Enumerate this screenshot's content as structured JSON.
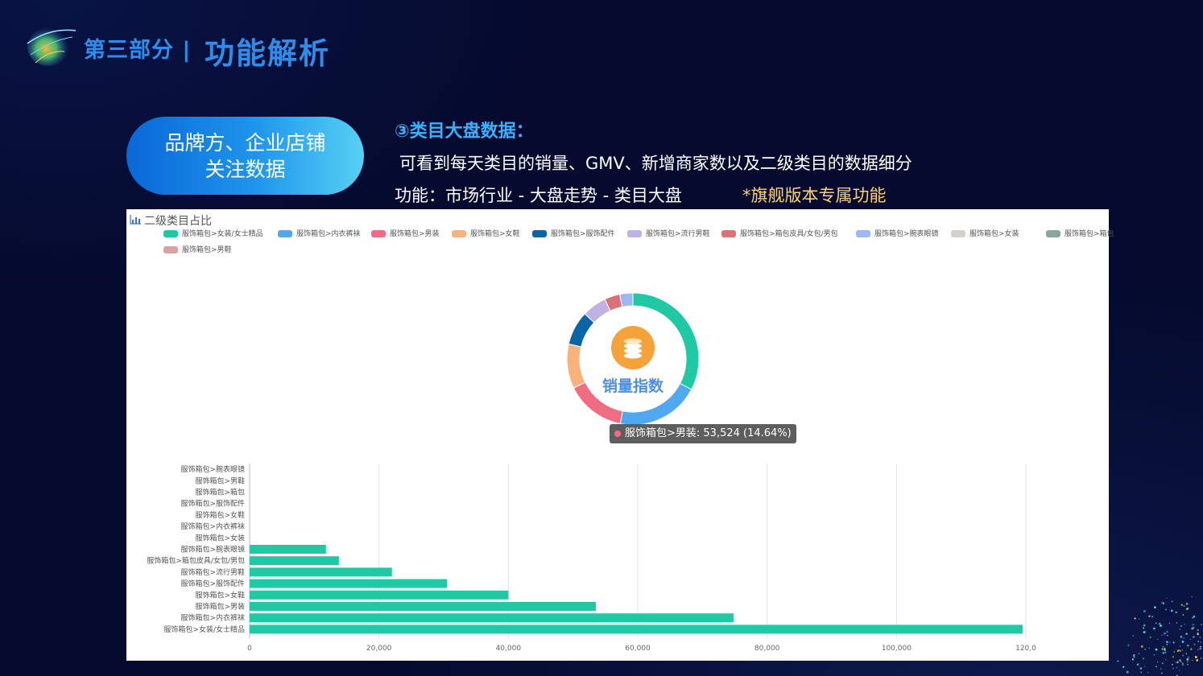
{
  "header": {
    "section_label": "第三部分 |",
    "section_title": "功能解析"
  },
  "pill": {
    "line1": "品牌方、企业店铺",
    "line2": "关注数据"
  },
  "feature": {
    "title": "③类目大盘数据：",
    "description": "可看到每天类目的销量、GMV、新增商家数以及二级类目的数据细分",
    "path": "功能：市场行业 - 大盘走势 - 类目大盘",
    "note": "*旗舰版本专属功能"
  },
  "panel": {
    "title": "二级类目占比",
    "center_label": "销量指数",
    "center_icon": "coins-icon",
    "tooltip": "服饰箱包>男装: 53,524 (14.64%)"
  },
  "legend": [
    {
      "label": "服饰箱包>女装/女士精品",
      "color": "#1ec9a3"
    },
    {
      "label": "服饰箱包>内衣裤袜",
      "color": "#4fa8f0"
    },
    {
      "label": "服饰箱包>男装",
      "color": "#f06c83"
    },
    {
      "label": "服饰箱包>女鞋",
      "color": "#f8b27a"
    },
    {
      "label": "服饰箱包>服饰配件",
      "color": "#0a64a8"
    },
    {
      "label": "服饰箱包>流行男鞋",
      "color": "#c0b3e4"
    },
    {
      "label": "服饰箱包>箱包皮具/女包/男包",
      "color": "#db7178"
    },
    {
      "label": "服饰箱包>腕表眼镜",
      "color": "#9ab8f6"
    },
    {
      "label": "服饰箱包>女装",
      "color": "#d8d0c8"
    },
    {
      "label": "服饰箱包>箱包",
      "color": "#8aa89a"
    },
    {
      "label": "服饰箱包>男鞋",
      "color": "#dba1a6"
    }
  ],
  "chart_data": [
    {
      "type": "pie",
      "subtype": "donut",
      "categories": [
        "服饰箱包>女装/女士精品",
        "服饰箱包>内衣裤袜",
        "服饰箱包>男装",
        "服饰箱包>女鞋",
        "服饰箱包>服饰配件",
        "服饰箱包>流行男鞋",
        "服饰箱包>箱包皮具/女包/男包",
        "服饰箱包>腕表眼镜"
      ],
      "values": [
        119500,
        74800,
        53524,
        40000,
        30500,
        22000,
        13800,
        11800
      ],
      "colors": [
        "#1ec9a3",
        "#4fa8f0",
        "#f06c83",
        "#f8b27a",
        "#0a64a8",
        "#c0b3e4",
        "#db7178",
        "#9ab8f6"
      ]
    },
    {
      "type": "bar",
      "orientation": "horizontal",
      "categories": [
        "服饰箱包>腕表眼镜",
        "服饰箱包>男鞋",
        "服饰箱包>箱包",
        "服饰箱包>服饰配件",
        "服饰箱包>女鞋",
        "服饰箱包>内衣裤袜",
        "服饰箱包>女装",
        "服饰箱包>腕表眼镜",
        "服饰箱包>箱包皮具/女包/男包",
        "服饰箱包>流行男鞋",
        "服饰箱包>服饰配件",
        "服饰箱包>女鞋",
        "服饰箱包>男装",
        "服饰箱包>内衣裤袜",
        "服饰箱包>女装/女士精品"
      ],
      "values": [
        0,
        0,
        0,
        0,
        0,
        0,
        0,
        11800,
        13800,
        22000,
        30500,
        40000,
        53524,
        74800,
        119500
      ],
      "xticks": [
        "0",
        "20,000",
        "40,000",
        "60,000",
        "80,000",
        "100,000",
        "120,0"
      ],
      "xlim": [
        0,
        120000
      ],
      "bar_color": "#1ec9a3",
      "grid": true
    }
  ]
}
